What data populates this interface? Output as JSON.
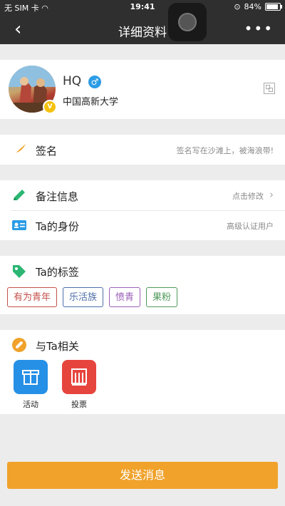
{
  "status_bar": {
    "carrier": "无 SIM 卡",
    "time": "19:41",
    "battery": "84%"
  },
  "nav": {
    "back_icon": "‹",
    "title": "详细资料",
    "more_icon": "•••"
  },
  "profile": {
    "nickname": "HQ",
    "gender_icon": "♂",
    "school": "中国高新大学",
    "verified_badge": "V"
  },
  "signature": {
    "label": "签名",
    "value": "签名写在沙滩上，被海浪带!"
  },
  "remark": {
    "label": "备注信息",
    "value": "点击修改"
  },
  "identity": {
    "label": "Ta的身份",
    "value": "高级认证用户"
  },
  "tags_section": {
    "label": "Ta的标签",
    "tags": [
      {
        "text": "有为青年",
        "color": "#c4504b"
      },
      {
        "text": "乐活族",
        "color": "#4e6fa8"
      },
      {
        "text": "愤青",
        "color": "#9a5fb6"
      },
      {
        "text": "果粉",
        "color": "#4f9a5a"
      }
    ]
  },
  "related": {
    "label": "与Ta相关",
    "apps": [
      {
        "name": "活动",
        "icon": "gift-icon",
        "color": "#2690e6"
      },
      {
        "name": "投票",
        "icon": "vote-icon",
        "color": "#e6453e"
      }
    ]
  },
  "action": {
    "send_label": "发送消息"
  },
  "colors": {
    "accent": "#f0a22b",
    "topbar": "#2f2f2f"
  }
}
